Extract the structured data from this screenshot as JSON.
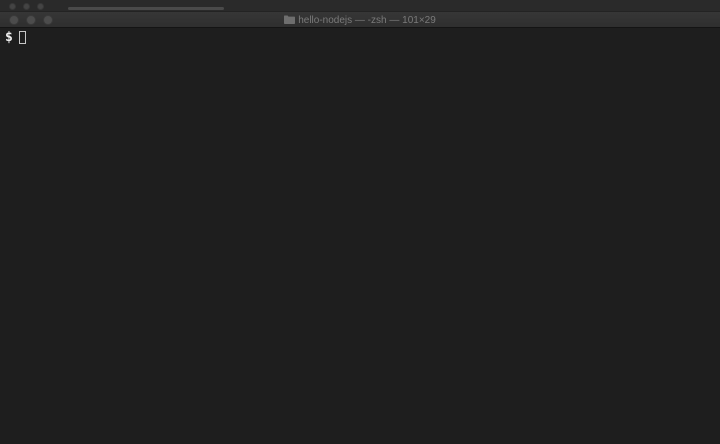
{
  "window": {
    "title": "hello-nodejs — -zsh — 101×29",
    "title_icon": "folder-icon"
  },
  "terminal": {
    "prompt": "$",
    "input": "",
    "background_color": "#1e1e1e",
    "text_color": "#e6e6e6"
  }
}
